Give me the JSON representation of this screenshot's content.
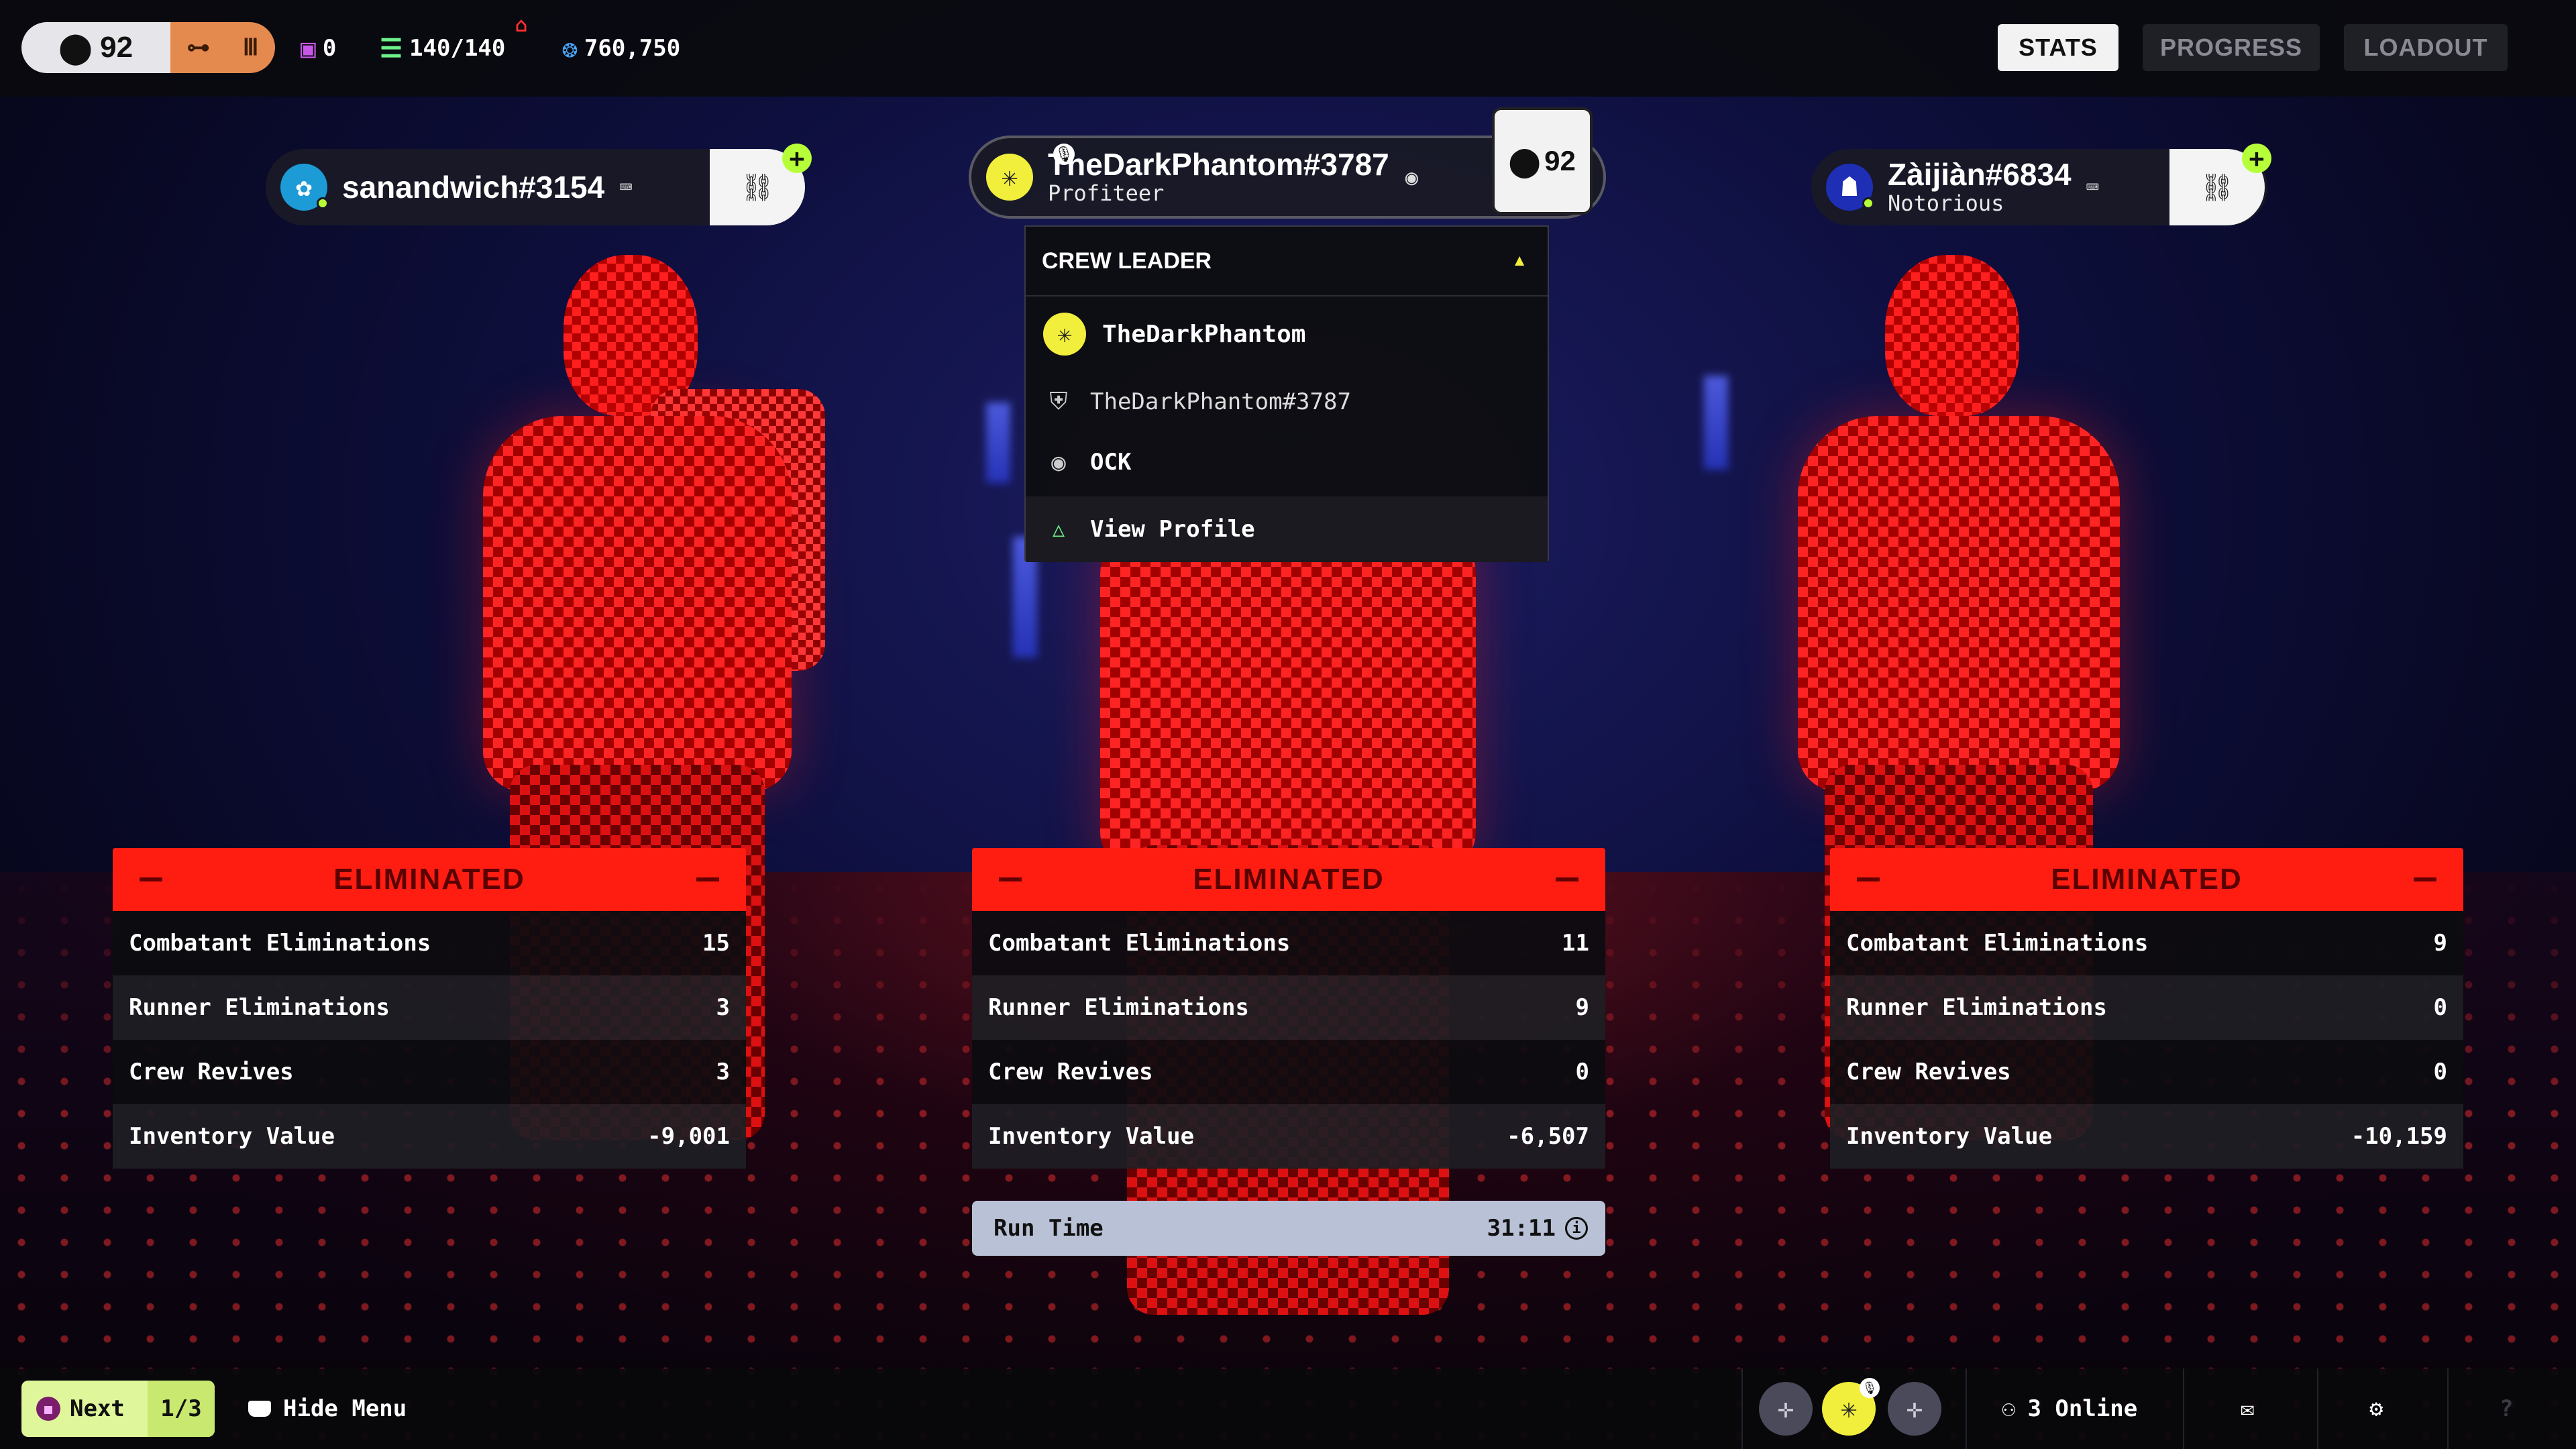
{
  "topbar": {
    "level": "92",
    "currencies": [
      {
        "icon": "square-badge-icon",
        "value": "0",
        "color": "#c857e8"
      },
      {
        "icon": "stack-icon",
        "value": "140/140",
        "color": "#6ef08a"
      },
      {
        "icon": "credit-icon",
        "value": "760,750",
        "color": "#4aa8ff"
      }
    ],
    "tabs": [
      "STATS",
      "PROGRESS",
      "LOADOUT"
    ],
    "active_tab": "STATS"
  },
  "players": [
    {
      "name": "sanandwich#3154",
      "title": ""
    },
    {
      "name": "TheDarkPhantom#3787",
      "title": "Profiteer",
      "level": "92"
    },
    {
      "name": "Zàijiàn#6834",
      "title": "Notorious"
    }
  ],
  "dropdown": {
    "header": "CREW LEADER",
    "rows": [
      {
        "icon": "avatar-icon",
        "label": "TheDarkPhantom"
      },
      {
        "icon": "bungie-icon",
        "label": "TheDarkPhantom#3787"
      },
      {
        "icon": "playstation-icon",
        "label": "OCK"
      },
      {
        "icon": "triangle-button-icon",
        "label": "View Profile"
      }
    ]
  },
  "cards": [
    {
      "status": "ELIMINATED",
      "stats": [
        {
          "label": "Combatant Eliminations",
          "value": "15"
        },
        {
          "label": "Runner Eliminations",
          "value": "3"
        },
        {
          "label": "Crew Revives",
          "value": "3"
        },
        {
          "label": "Inventory Value",
          "value": "-9,001"
        }
      ]
    },
    {
      "status": "ELIMINATED",
      "stats": [
        {
          "label": "Combatant Eliminations",
          "value": "11"
        },
        {
          "label": "Runner Eliminations",
          "value": "9"
        },
        {
          "label": "Crew Revives",
          "value": "0"
        },
        {
          "label": "Inventory Value",
          "value": "-6,507"
        }
      ]
    },
    {
      "status": "ELIMINATED",
      "stats": [
        {
          "label": "Combatant Eliminations",
          "value": "9"
        },
        {
          "label": "Runner Eliminations",
          "value": "0"
        },
        {
          "label": "Crew Revives",
          "value": "0"
        },
        {
          "label": "Inventory Value",
          "value": "-10,159"
        }
      ]
    }
  ],
  "runtime": {
    "label": "Run Time",
    "value": "31:11"
  },
  "bottombar": {
    "next_label": "Next",
    "next_count": "1/3",
    "hide_menu": "Hide Menu",
    "online": "3 Online"
  },
  "colors": {
    "accent_red": "#ff1d12",
    "lime": "#b6ff38",
    "orange": "#e58a4f"
  }
}
